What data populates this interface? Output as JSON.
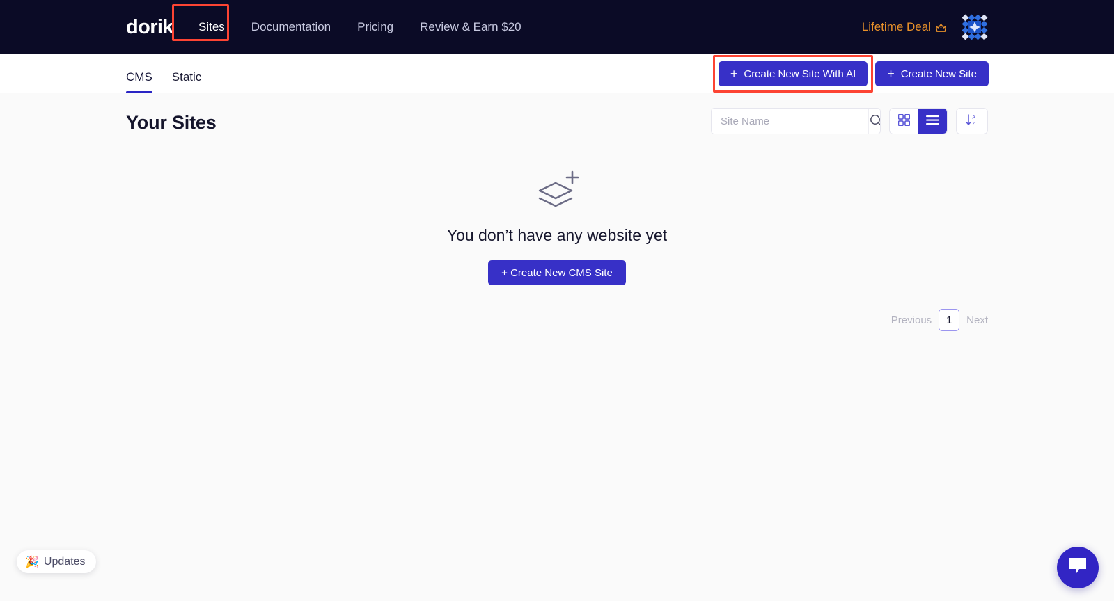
{
  "brand": {
    "logo_text": "dorik",
    "accent": "#3730c7",
    "header_bg": "#0b0b26",
    "highlight": "#fd4433"
  },
  "topnav": {
    "links": [
      {
        "label": "Sites",
        "active": true
      },
      {
        "label": "Documentation",
        "active": false
      },
      {
        "label": "Pricing",
        "active": false
      },
      {
        "label": "Review & Earn $20",
        "active": false
      }
    ],
    "lifetime_deal": {
      "label": "Lifetime Deal",
      "icon": "crown-icon",
      "color": "#e8912a"
    },
    "avatar": {
      "icon": "identicon-avatar"
    }
  },
  "subnav": {
    "tabs": [
      {
        "label": "CMS",
        "active": true
      },
      {
        "label": "Static",
        "active": false
      }
    ],
    "create_ai_button": {
      "label": "Create New Site With AI",
      "icon": "plus-icon",
      "highlighted": true
    },
    "create_button": {
      "label": "Create New Site",
      "icon": "plus-icon",
      "highlighted": false
    }
  },
  "main": {
    "title": "Your Sites",
    "search": {
      "value": "",
      "placeholder": "Site Name",
      "icon": "search-icon"
    },
    "view_toggle": {
      "grid": {
        "icon": "grid-view-icon",
        "active": false
      },
      "list": {
        "icon": "list-view-icon",
        "active": true
      }
    },
    "sort": {
      "icon": "sort-az-icon"
    },
    "empty_state": {
      "icon": "layers-plus-icon",
      "message": "You don’t have any website yet",
      "button_label": "+ Create New CMS Site"
    },
    "pagination": {
      "previous": "Previous",
      "current_page": "1",
      "next": "Next"
    }
  },
  "widgets": {
    "updates": {
      "emoji": "🎉",
      "label": "Updates"
    },
    "chat": {
      "icon": "chat-bubble-icon"
    }
  }
}
